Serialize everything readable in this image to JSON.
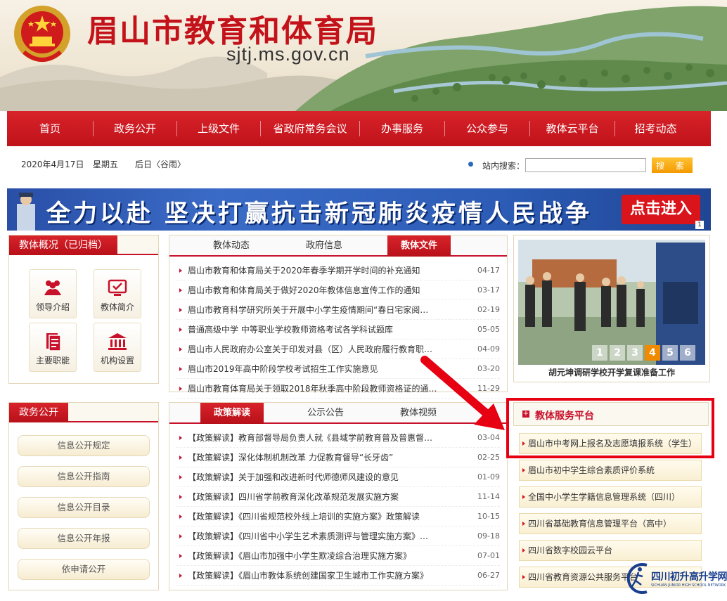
{
  "header": {
    "title": "眉山市教育和体育局",
    "url": "sjtj.ms.gov.cn"
  },
  "nav": [
    "首页",
    "政务公开",
    "上级文件",
    "省政府常务会议",
    "办事服务",
    "公众参与",
    "教体云平台",
    "招考动态"
  ],
  "datebar": {
    "date": "2020年4月17日",
    "weekday": "星期五",
    "weather": "后日〈谷雨〉",
    "search_label": "站内搜索：",
    "search_value": "",
    "search_button": "搜 索"
  },
  "campaign": {
    "text": "全力以赴  坚决打赢抗击新冠肺炎疫情人民战争",
    "button": "点击进入",
    "index": "1"
  },
  "overview": {
    "title": "教体概况（已归档）",
    "tiles": [
      {
        "label": "领导介绍",
        "icon": "people-icon"
      },
      {
        "label": "教体简介",
        "icon": "monitor-icon"
      },
      {
        "label": "主要职能",
        "icon": "document-icon"
      },
      {
        "label": "机构设置",
        "icon": "building-icon"
      }
    ]
  },
  "open_gov": {
    "title": "政务公开",
    "items": [
      "信息公开规定",
      "信息公开指南",
      "信息公开目录",
      "信息公开年报",
      "依申请公开"
    ]
  },
  "news1": {
    "tabs": [
      "教体动态",
      "政府信息",
      "教体文件"
    ],
    "active": 2,
    "rows": [
      {
        "title": "眉山市教育和体育局关于2020年春季学期开学时间的补充通知",
        "date": "04-17"
      },
      {
        "title": "眉山市教育和体育局关于做好2020年教体信息宣传工作的通知",
        "date": "03-17"
      },
      {
        "title": "眉山市教育科学研究所关于开展中小学生疫情期间“春日宅家阅…",
        "date": "02-19"
      },
      {
        "title": "普通高级中学  中等职业学校教师资格考试各学科试题库",
        "date": "05-05"
      },
      {
        "title": "眉山市人民政府办公室关于印发对县（区）人民政府履行教育职…",
        "date": "04-09"
      },
      {
        "title": "眉山市2019年高中阶段学校考试招生工作实施意见",
        "date": "03-20"
      },
      {
        "title": "眉山市教育体育局关于领取2018年秋季高中阶段教师资格证的通…",
        "date": "11-29"
      }
    ]
  },
  "news2": {
    "tabs": [
      "政策解读",
      "公示公告",
      "教体视频"
    ],
    "active": 0,
    "rows": [
      {
        "title": "【政策解读】教育部督导局负责人就《县域学前教育普及普惠督…",
        "date": "03-04"
      },
      {
        "title": "【政策解读】深化体制机制改革 力促教育督导“长牙齿”",
        "date": "02-25"
      },
      {
        "title": "【政策解读】关于加强和改进新时代师德师风建设的意见",
        "date": "01-09"
      },
      {
        "title": "【政策解读】四川省学前教育深化改革规范发展实施方案",
        "date": "11-14"
      },
      {
        "title": "【政策解读】《四川省规范校外线上培训的实施方案》政策解读",
        "date": "10-15"
      },
      {
        "title": "【政策解读】《四川省中小学生艺术素质测评与管理实施方案》…",
        "date": "09-18"
      },
      {
        "title": "【政策解读】《眉山市加强中小学生欺凌综合治理实施方案》",
        "date": "07-01"
      },
      {
        "title": "【政策解读】《眉山市教体系统创建国家卫生城市工作实施方案》",
        "date": "06-27"
      }
    ]
  },
  "slideshow": {
    "caption": "胡元坤调研学校开学复课准备工作",
    "numbers": [
      "1",
      "2",
      "3",
      "4",
      "5",
      "6"
    ],
    "active": 3
  },
  "services": {
    "title": "教体服务平台",
    "items": [
      "眉山市中考网上报名及志愿填报系统（学生）",
      "眉山市初中学生综合素质评价系统",
      "全国中小学生学籍信息管理系统（四川）",
      "四川省基础教育信息管理平台（高中）",
      "四川省数字校园云平台",
      "四川省教育资源公共服务平台"
    ]
  },
  "watermark": {
    "text": "四川初升高升学网",
    "sub": "SICHUAN JUNIOR HIGH SCHOOL NETWORK"
  },
  "colors": {
    "primary_red": "#c8112b",
    "annotation_red": "#e60012",
    "accent_orange": "#f39a00"
  }
}
